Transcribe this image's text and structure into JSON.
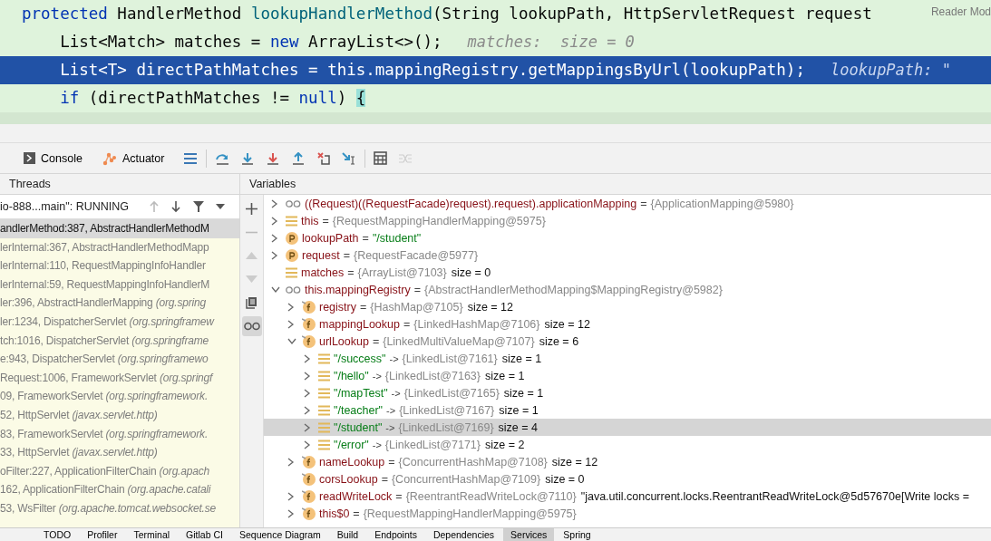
{
  "editor": {
    "reader_mode": "Reader Mod",
    "lines": [
      {
        "selected": false,
        "tokens": [
          {
            "kind": "keyword",
            "text": "protected "
          },
          {
            "kind": "plain",
            "text": "HandlerMethod "
          },
          {
            "kind": "method",
            "text": "lookupHandlerMethod"
          },
          {
            "kind": "plain",
            "text": "(String lookupPath, HttpServletRequest request"
          }
        ]
      },
      {
        "selected": false,
        "tokens": [
          {
            "kind": "plain",
            "text": "    List<Match> matches = "
          },
          {
            "kind": "keyword",
            "text": "new "
          },
          {
            "kind": "plain",
            "text": "ArrayList<>();"
          },
          {
            "kind": "hint",
            "text": "matches:  size = 0"
          }
        ]
      },
      {
        "selected": true,
        "tokens": [
          {
            "kind": "plain",
            "text": "    List<T> directPathMatches = this.mappingRegistry.getMappingsByUrl(lookupPath);"
          },
          {
            "kind": "hint",
            "text": "lookupPath: \""
          }
        ]
      },
      {
        "selected": false,
        "tokens": [
          {
            "kind": "keyword",
            "text": "    if "
          },
          {
            "kind": "plain",
            "text": "(directPathMatches != "
          },
          {
            "kind": "keyword",
            "text": "null"
          },
          {
            "kind": "plain",
            "text": ") "
          },
          {
            "kind": "brace",
            "text": "{"
          }
        ]
      }
    ]
  },
  "toolbar": {
    "tabs": [
      {
        "label": "Console"
      },
      {
        "label": "Actuator"
      }
    ],
    "actions": [
      {
        "enabled": true
      },
      {
        "enabled": true
      },
      {
        "enabled": true
      },
      {
        "enabled": true
      },
      {
        "enabled": true
      },
      {
        "enabled": true
      },
      {
        "enabled": true
      },
      {
        "enabled": true
      },
      {
        "enabled": false
      }
    ]
  },
  "threads": {
    "title": "Threads",
    "thread": "io-888...main\": RUNNING",
    "frames": [
      {
        "selected": true,
        "location": "andlerMethod:387, AbstractHandlerMethodM"
      },
      {
        "selected": false,
        "location": "lerInternal:367, AbstractHandlerMethodMapp"
      },
      {
        "selected": false,
        "location": "lerInternal:110, RequestMappingInfoHandler"
      },
      {
        "selected": false,
        "location": "lerInternal:59, RequestMappingInfoHandlerM"
      },
      {
        "selected": false,
        "location": "ler:396, AbstractHandlerMapping",
        "package": "(org.spring"
      },
      {
        "selected": false,
        "location": "ler:1234, DispatcherServlet",
        "package": "(org.springframew"
      },
      {
        "selected": false,
        "location": "tch:1016, DispatcherServlet",
        "package": "(org.springframe"
      },
      {
        "selected": false,
        "location": "e:943, DispatcherServlet",
        "package": "(org.springframewo"
      },
      {
        "selected": false,
        "location": "Request:1006, FrameworkServlet",
        "package": "(org.springf"
      },
      {
        "selected": false,
        "location": "09, FrameworkServlet",
        "package": "(org.springframework."
      },
      {
        "selected": false,
        "location": "52, HttpServlet",
        "package": "(javax.servlet.http)"
      },
      {
        "selected": false,
        "location": "83, FrameworkServlet",
        "package": "(org.springframework."
      },
      {
        "selected": false,
        "location": "33, HttpServlet",
        "package": "(javax.servlet.http)"
      },
      {
        "selected": false,
        "location": "oFilter:227, ApplicationFilterChain",
        "package": "(org.apach"
      },
      {
        "selected": false,
        "location": "162, ApplicationFilterChain",
        "package": "(org.apache.catali"
      },
      {
        "selected": false,
        "location": "53, WsFilter",
        "package": "(org.apache.tomcat.websocket.se"
      }
    ]
  },
  "variables": {
    "title": "Variables",
    "side_buttons": [
      {
        "selected": false
      },
      {
        "selected": false
      },
      {
        "selected": false
      },
      {
        "selected": false
      },
      {
        "selected": false
      },
      {
        "selected": true
      }
    ],
    "items": [
      {
        "kind": "watch",
        "expanded": false,
        "selected": false,
        "name": "((Request)((RequestFacade)request).request).applicationMapping",
        "op": "=",
        "value": "{ApplicationMapping@5980}"
      },
      {
        "kind": "local",
        "expanded": false,
        "selected": false,
        "name": "this",
        "op": "=",
        "value": "{RequestMappingHandlerMapping@5975}"
      },
      {
        "kind": "param",
        "expanded": false,
        "selected": false,
        "name": "lookupPath",
        "op": "=",
        "string": "\"/student\""
      },
      {
        "kind": "param",
        "expanded": false,
        "selected": false,
        "name": "request",
        "op": "=",
        "value": "{RequestFacade@5977}"
      },
      {
        "kind": "local",
        "selected": false,
        "name": "matches",
        "op": "=",
        "value": "{ArrayList@7103}",
        "extra": "size = 0"
      },
      {
        "kind": "watch",
        "expanded": true,
        "selected": false,
        "name": "this.mappingRegistry",
        "op": "=",
        "value": "{AbstractHandlerMethodMapping$MappingRegistry@5982}",
        "children": [
          {
            "kind": "field",
            "expanded": false,
            "selected": false,
            "name": "registry",
            "op": "=",
            "value": "{HashMap@7105}",
            "extra": "size = 12"
          },
          {
            "kind": "field",
            "expanded": false,
            "selected": false,
            "name": "mappingLookup",
            "op": "=",
            "value": "{LinkedHashMap@7106}",
            "extra": "size = 12"
          },
          {
            "kind": "field",
            "expanded": true,
            "selected": false,
            "name": "urlLookup",
            "op": "=",
            "value": "{LinkedMultiValueMap@7107}",
            "extra": "size = 6",
            "children": [
              {
                "kind": "entry",
                "expanded": false,
                "selected": false,
                "name": "\"/success\"",
                "op": "->",
                "value": "{LinkedList@7161}",
                "extra": "size = 1"
              },
              {
                "kind": "entry",
                "expanded": false,
                "selected": false,
                "name": "\"/hello\"",
                "op": "->",
                "value": "{LinkedList@7163}",
                "extra": "size = 1"
              },
              {
                "kind": "entry",
                "expanded": false,
                "selected": false,
                "name": "\"/mapTest\"",
                "op": "->",
                "value": "{LinkedList@7165}",
                "extra": "size = 1"
              },
              {
                "kind": "entry",
                "expanded": false,
                "selected": false,
                "name": "\"/teacher\"",
                "op": "->",
                "value": "{LinkedList@7167}",
                "extra": "size = 1"
              },
              {
                "kind": "entry",
                "expanded": false,
                "selected": true,
                "name": "\"/student\"",
                "op": "->",
                "value": "{LinkedList@7169}",
                "extra": "size = 4"
              },
              {
                "kind": "entry",
                "expanded": false,
                "selected": false,
                "name": "\"/error\"",
                "op": "->",
                "value": "{LinkedList@7171}",
                "extra": "size = 2"
              }
            ]
          },
          {
            "kind": "field",
            "expanded": false,
            "selected": false,
            "name": "nameLookup",
            "op": "=",
            "value": "{ConcurrentHashMap@7108}",
            "extra": "size = 12"
          },
          {
            "kind": "field",
            "selected": false,
            "name": "corsLookup",
            "op": "=",
            "value": "{ConcurrentHashMap@7109}",
            "extra": "size = 0"
          },
          {
            "kind": "field",
            "expanded": false,
            "selected": false,
            "name": "readWriteLock",
            "op": "=",
            "value": "{ReentrantReadWriteLock@7110}",
            "extra": "\"java.util.concurrent.locks.ReentrantReadWriteLock@5d57670e[Write locks ="
          },
          {
            "kind": "field",
            "expanded": false,
            "selected": false,
            "name": "this$0",
            "op": "=",
            "value": "{RequestMappingHandlerMapping@5975}"
          }
        ]
      }
    ]
  },
  "bottom_bar": [
    {
      "label": "TODO",
      "selected": false
    },
    {
      "label": "Profiler",
      "selected": false
    },
    {
      "label": "Terminal",
      "selected": false
    },
    {
      "label": "Gitlab CI",
      "selected": false
    },
    {
      "label": "Sequence Diagram",
      "selected": false
    },
    {
      "label": "Build",
      "selected": false
    },
    {
      "label": "Endpoints",
      "selected": false
    },
    {
      "label": "Dependencies",
      "selected": false
    },
    {
      "label": "Services",
      "selected": true
    },
    {
      "label": "Spring",
      "selected": false
    }
  ]
}
